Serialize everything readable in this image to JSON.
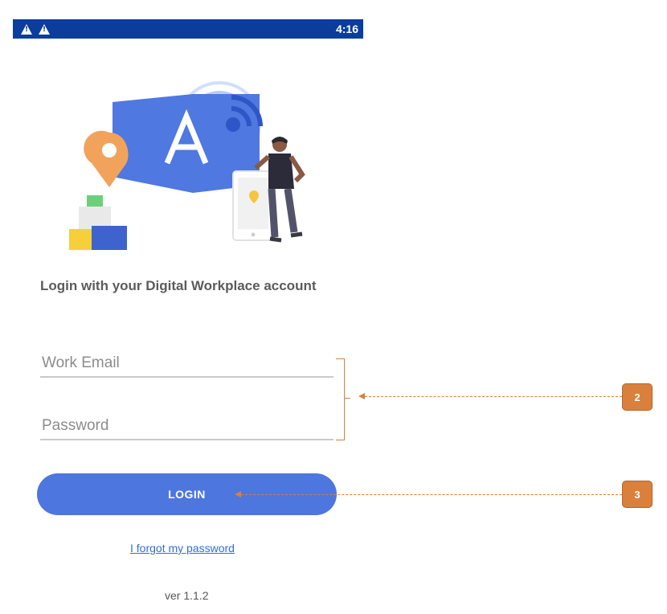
{
  "status_bar": {
    "time": "4:16",
    "icons": [
      "warning-icon",
      "warning-icon"
    ]
  },
  "heading": "Login with your Digital Workplace account",
  "form": {
    "email_placeholder": "Work Email",
    "password_placeholder": "Password",
    "login_label": "LOGIN"
  },
  "forgot_password": "I forgot my password",
  "version": "ver 1.1.2",
  "annotations": [
    {
      "number": "2"
    },
    {
      "number": "3"
    }
  ],
  "colors": {
    "status_bar": "#0a3d9c",
    "button": "#4d76df",
    "link": "#2f6fd9",
    "annotation": "#d9803d"
  }
}
